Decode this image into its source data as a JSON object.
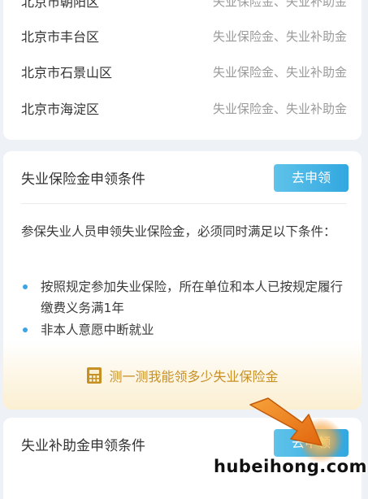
{
  "districts": [
    {
      "name": "北京市朝阳区",
      "benefit": "失业保险金、失业补助金"
    },
    {
      "name": "北京市丰台区",
      "benefit": "失业保险金、失业补助金"
    },
    {
      "name": "北京市石景山区",
      "benefit": "失业保险金、失业补助金"
    },
    {
      "name": "北京市海淀区",
      "benefit": "失业保险金、失业补助金"
    }
  ],
  "insurance": {
    "title": "失业保险金申领条件",
    "apply_label": "去申领",
    "description": "参保失业人员申领失业保险金，必须同时满足以下条件：",
    "conditions": [
      "按照规定参加失业保险，所在单位和本人已按规定履行缴费义务满1年",
      "非本人意愿中断就业"
    ],
    "calculator_label": "测一测我能领多少失业保险金",
    "calculator_icon": "calculator-icon"
  },
  "subsidy": {
    "title": "失业补助金申领条件",
    "apply_label": "去申领"
  },
  "watermark": "hubeihong.com",
  "colors": {
    "accent": "#3aa5e6",
    "button": "#32a7e0",
    "calc_text": "#c79024",
    "arrow": "#f08a1c"
  }
}
